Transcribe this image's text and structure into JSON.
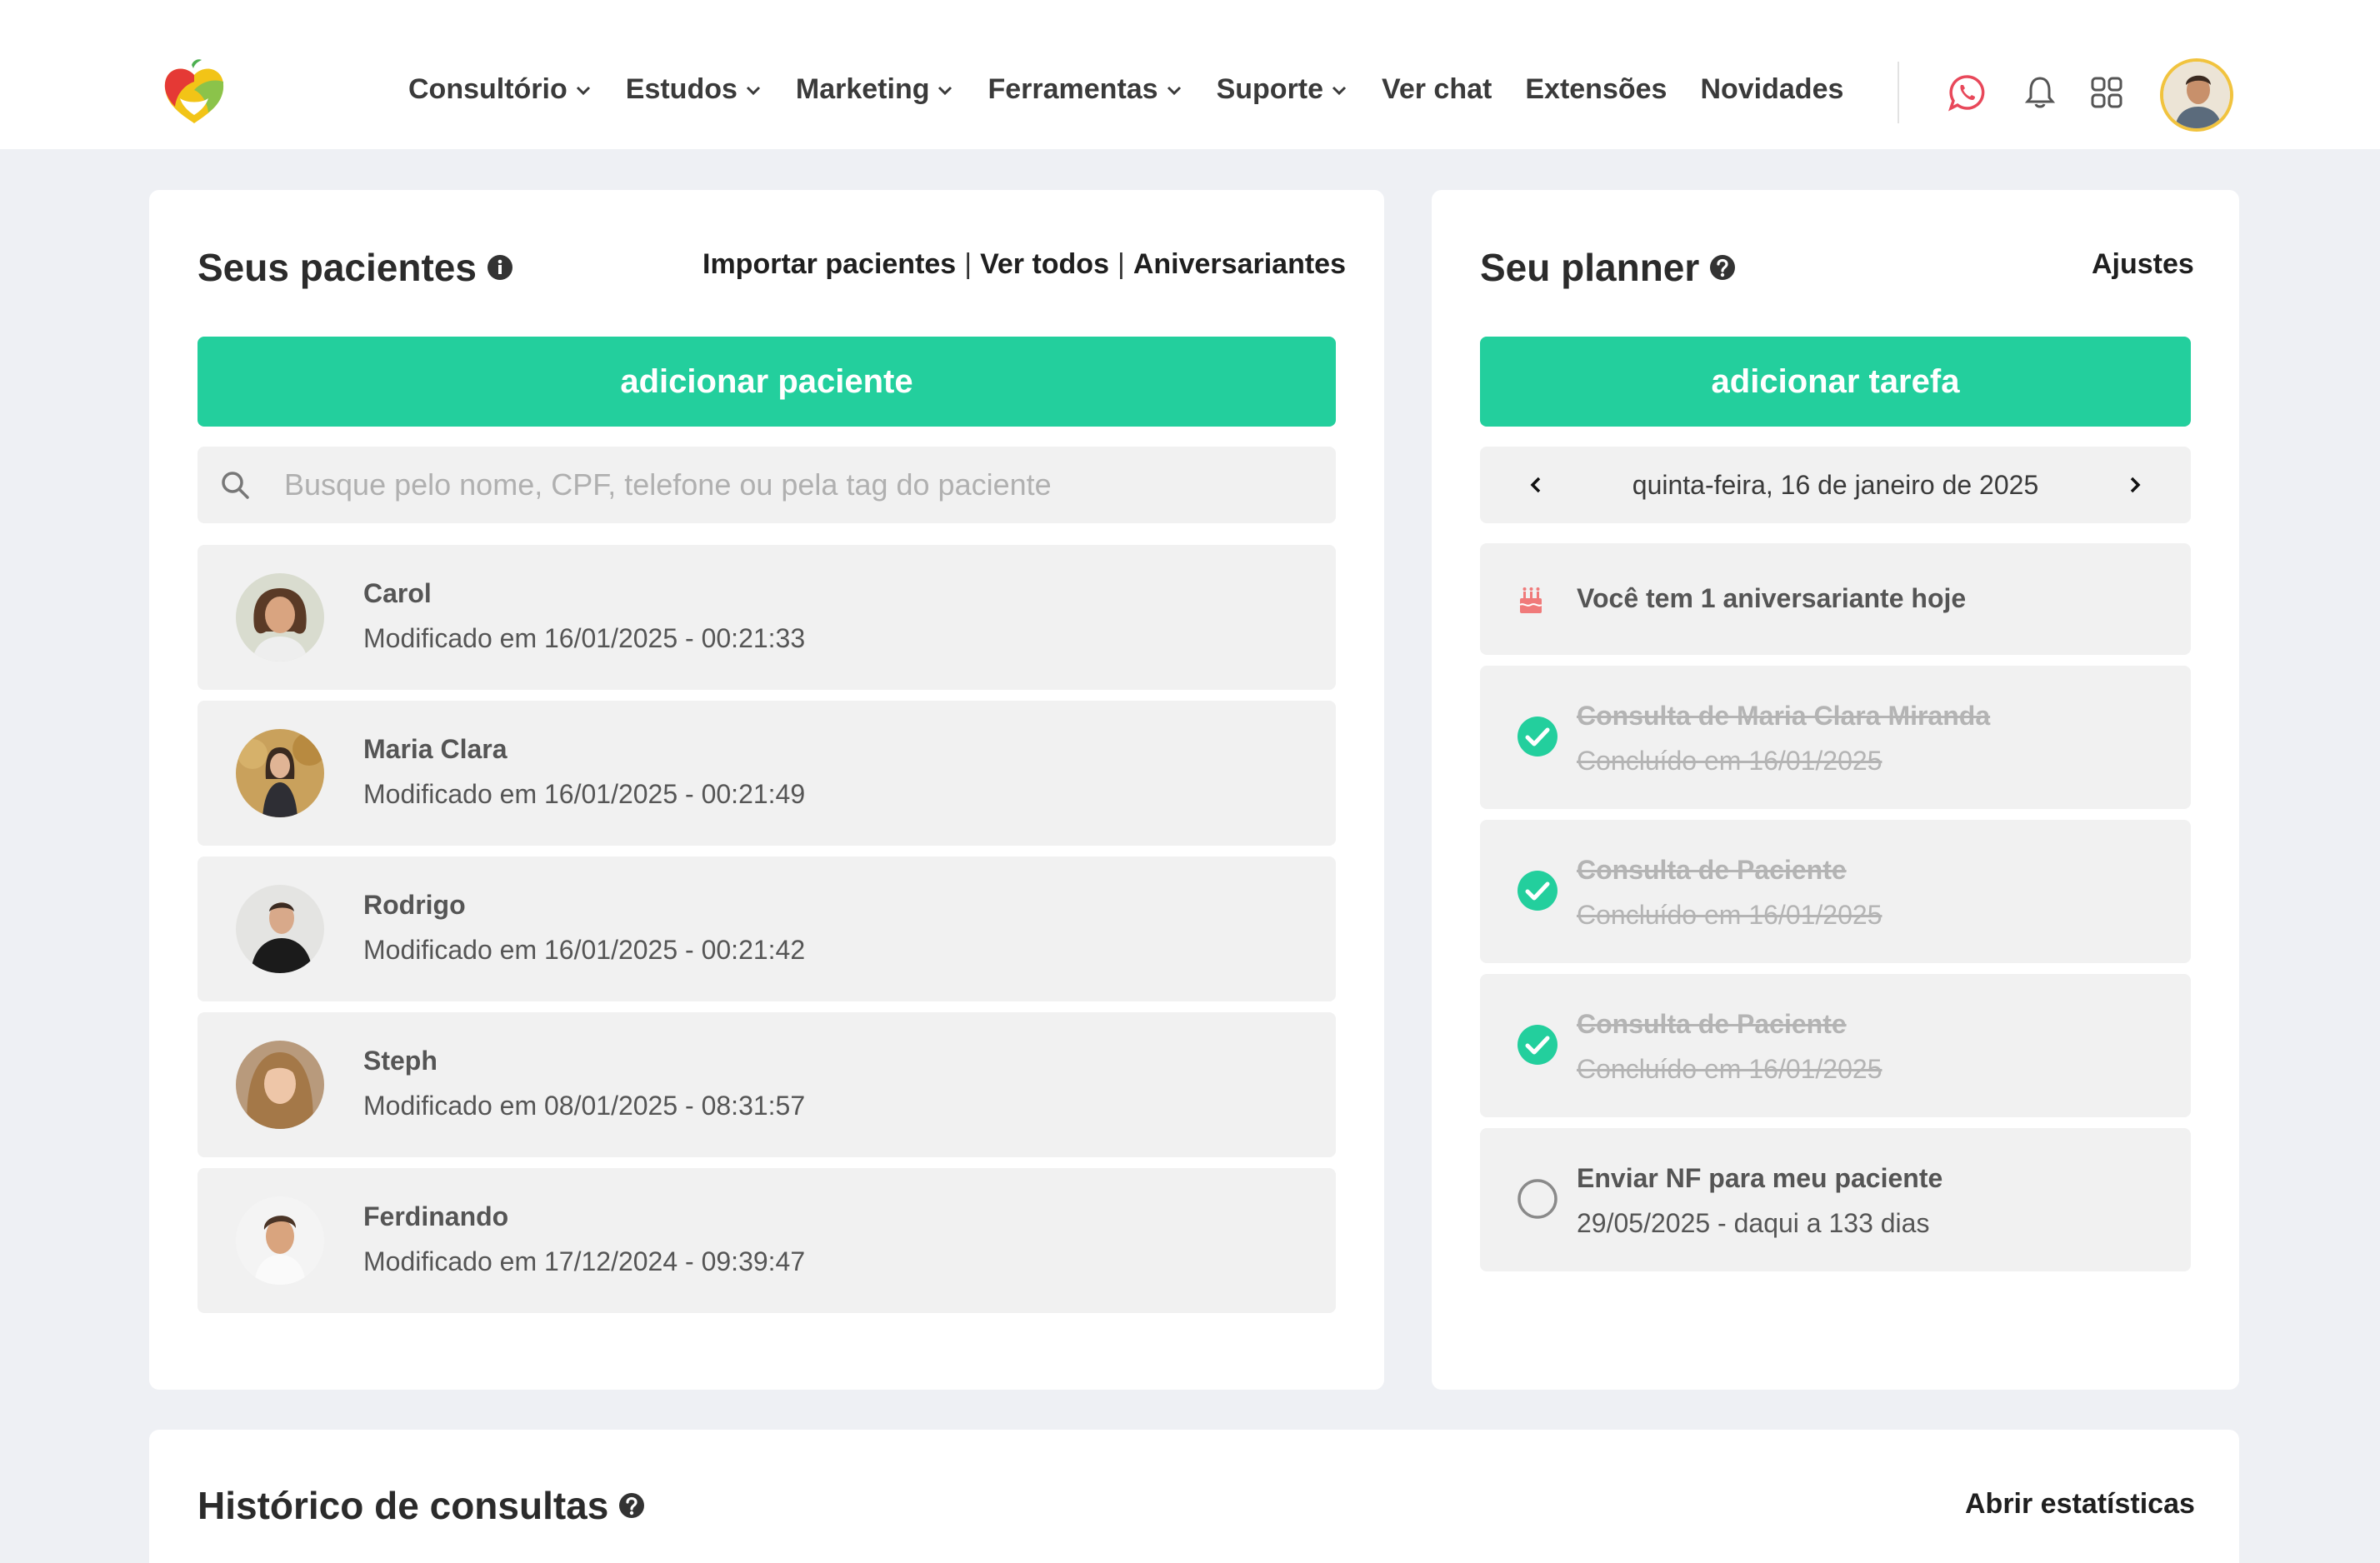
{
  "header": {
    "nav": [
      {
        "label": "Consultório",
        "dropdown": true
      },
      {
        "label": "Estudos",
        "dropdown": true
      },
      {
        "label": "Marketing",
        "dropdown": true
      },
      {
        "label": "Ferramentas",
        "dropdown": true
      },
      {
        "label": "Suporte",
        "dropdown": true
      },
      {
        "label": "Ver chat",
        "dropdown": false
      },
      {
        "label": "Extensões",
        "dropdown": false
      },
      {
        "label": "Novidades",
        "dropdown": false
      }
    ],
    "icons": [
      "whatsapp-icon",
      "bell-icon",
      "apps-grid-icon",
      "user-avatar"
    ]
  },
  "patients": {
    "title": "Seus pacientes",
    "links": {
      "import": "Importar pacientes",
      "view_all": "Ver todos",
      "birthdays": "Aniversariantes"
    },
    "add_button": "adicionar paciente",
    "search_placeholder": "Busque pelo nome, CPF, telefone ou pela tag do paciente",
    "list": [
      {
        "name": "Carol",
        "modified": "Modificado em 16/01/2025 - 00:21:33"
      },
      {
        "name": "Maria Clara",
        "modified": "Modificado em 16/01/2025 - 00:21:49"
      },
      {
        "name": "Rodrigo",
        "modified": "Modificado em 16/01/2025 - 00:21:42"
      },
      {
        "name": "Steph",
        "modified": "Modificado em 08/01/2025 - 08:31:57"
      },
      {
        "name": "Ferdinando",
        "modified": "Modificado em 17/12/2024 - 09:39:47"
      }
    ]
  },
  "planner": {
    "title": "Seu planner",
    "settings": "Ajustes",
    "add_button": "adicionar tarefa",
    "date": "quinta-feira, 16 de janeiro de 2025",
    "birthday_notice": "Você tem 1 aniversariante hoje",
    "tasks": [
      {
        "title": "Consulta de Maria Clara Miranda",
        "subtitle": "Concluído em 16/01/2025",
        "done": true
      },
      {
        "title": "Consulta de Paciente",
        "subtitle": "Concluído em 16/01/2025",
        "done": true
      },
      {
        "title": "Consulta de Paciente",
        "subtitle": "Concluído em 16/01/2025",
        "done": true
      },
      {
        "title": "Enviar NF para meu paciente",
        "subtitle": "29/05/2025 - daqui a 133 dias",
        "done": false
      }
    ]
  },
  "history": {
    "title": "Histórico de consultas",
    "stats_link": "Abrir estatísticas"
  },
  "colors": {
    "accent": "#23cf9d",
    "background": "#eef0f4",
    "card": "#ffffff",
    "row": "#f1f1f1",
    "whatsapp": "#e8485a",
    "avatar_border": "#f1c33e"
  }
}
